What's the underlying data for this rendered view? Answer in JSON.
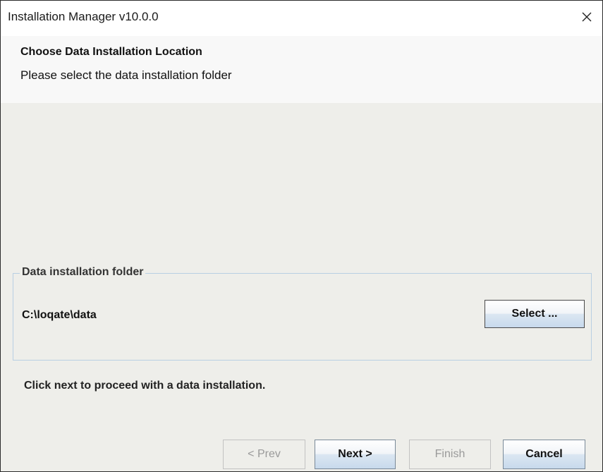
{
  "window": {
    "title": "Installation Manager v10.0.0",
    "close_icon": "close-icon"
  },
  "header": {
    "title": "Choose Data Installation Location",
    "subtitle": "Please select the data installation folder"
  },
  "folder_group": {
    "legend": "Data installation folder",
    "path": "C:\\loqate\\data",
    "select_label": "Select ..."
  },
  "instruction": "Click next to proceed with a data installation.",
  "buttons": {
    "prev": "< Prev",
    "next": "Next >",
    "finish": "Finish",
    "cancel": "Cancel"
  },
  "states": {
    "prev_enabled": false,
    "finish_enabled": false
  }
}
